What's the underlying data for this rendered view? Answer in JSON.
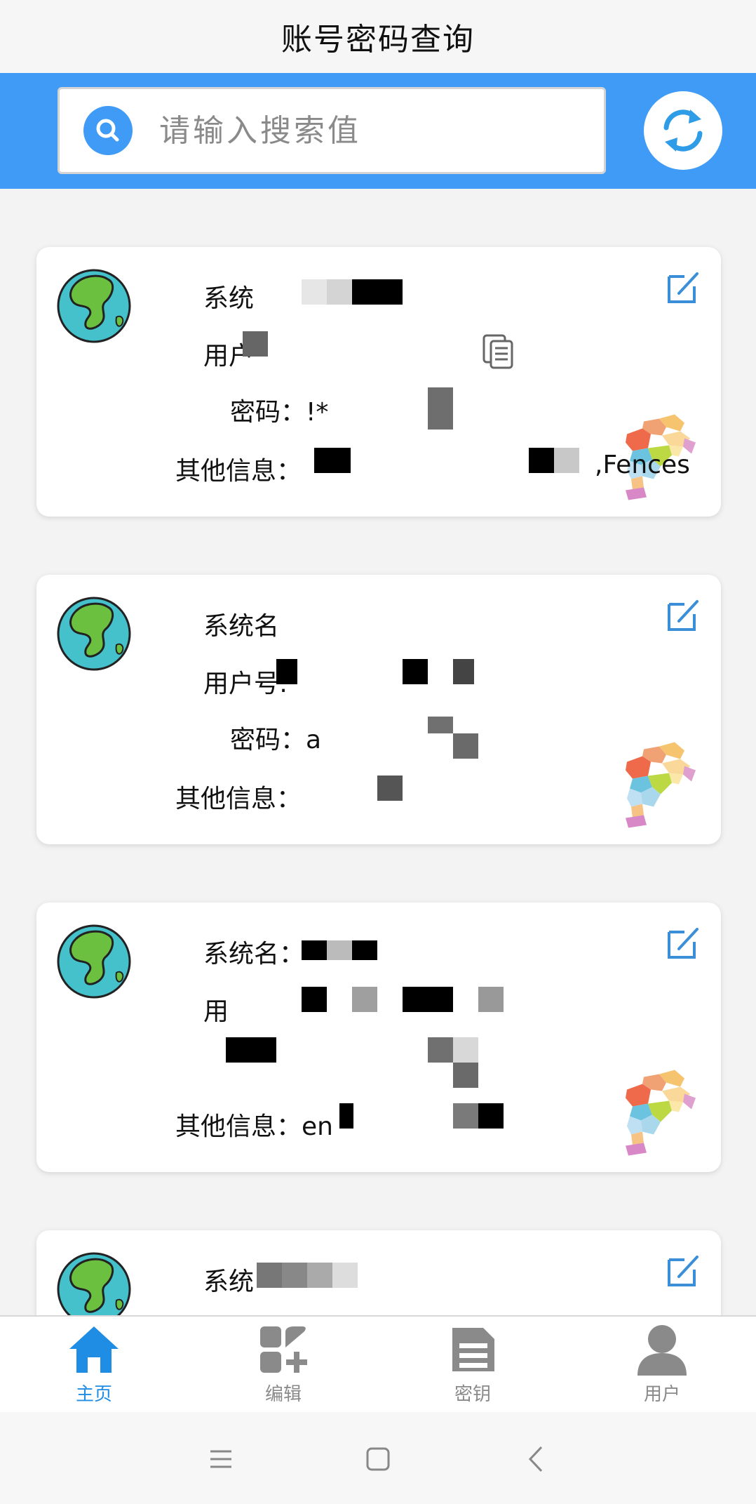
{
  "app": {
    "title": "账号密码查询"
  },
  "search": {
    "placeholder": "请输入搜索值"
  },
  "labels": {
    "system": "系统名",
    "user": "用户号",
    "password": "密码：",
    "other": "其他信息："
  },
  "cards": [
    {
      "system_text": "系统",
      "user_text": "用户",
      "password_text": "密码：!*",
      "other_text": "其他信息：",
      "other_tail": ",Fences"
    },
    {
      "system_text": "系统名",
      "user_text": "用户号:",
      "password_text": "密码：a",
      "other_text": "其他信息："
    },
    {
      "system_text": "系统名：",
      "user_text": "用",
      "other_text": "其他信息：en"
    },
    {
      "system_text": "系统"
    }
  ],
  "nav": {
    "items": [
      {
        "label": "主页",
        "icon": "home-icon",
        "active": true
      },
      {
        "label": "编辑",
        "icon": "edit-grid-icon",
        "active": false
      },
      {
        "label": "密钥",
        "icon": "document-icon",
        "active": false
      },
      {
        "label": "用户",
        "icon": "user-icon",
        "active": false
      }
    ]
  },
  "colors": {
    "accent": "#3f9bf6",
    "nav_active": "#1f8de4",
    "edit_icon": "#3b8fd8"
  }
}
